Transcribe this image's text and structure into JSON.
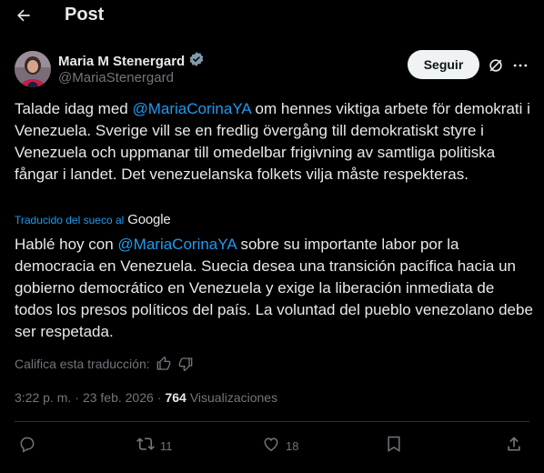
{
  "header": {
    "title": "Post",
    "back_icon": "arrow-left-icon"
  },
  "author": {
    "name": "Maria M Stenergard",
    "handle": "@MariaStenergard",
    "verified_color": "#829aab",
    "follow_label": "Seguir"
  },
  "original": {
    "before": "Talade idag med ",
    "mention": "@MariaCorinaYA",
    "after": " om hennes viktiga arbete för demokrati i Venezuela. Sverige vill se en fredlig övergång till demokratiskt styre i Venezuela och uppmanar till omedelbar frigivning av samtliga politiska fångar i landet. Det venezuelanska folkets vilja måste respekteras."
  },
  "translation": {
    "label": "Traducido del sueco al",
    "provider": "Google",
    "before": "Hablé hoy con ",
    "mention": "@MariaCorinaYA",
    "after": " sobre su importante labor por la democracia en Venezuela. Suecia desea una transición pacífica hacia un gobierno democrático en Venezuela y exige la liberación inmediata de todos los presos políticos del país. La voluntad del pueblo venezolano debe ser respetada.",
    "rate_label": "Califica esta traducción:"
  },
  "meta": {
    "time": "3:22 p. m.",
    "dot": "·",
    "date": "23 feb. 2026",
    "views_count": "764",
    "views_label": "Visualizaciones"
  },
  "actions": {
    "reposts": "11",
    "likes": "18"
  },
  "colors": {
    "accent": "#1d9bf0",
    "muted": "#71767b",
    "text": "#e7e9ea"
  }
}
